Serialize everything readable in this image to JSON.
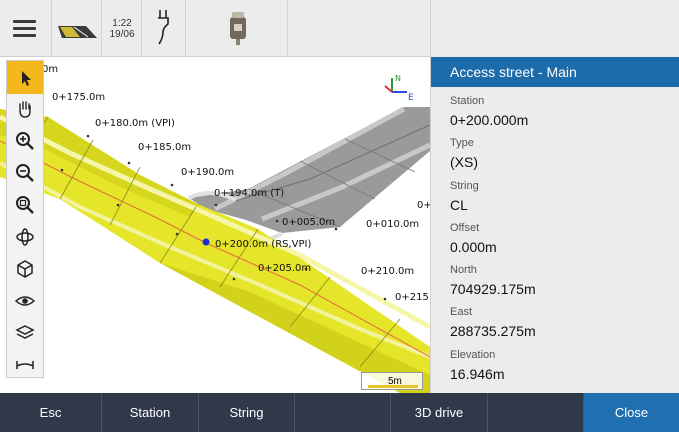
{
  "status_bar": {
    "time": "1:22",
    "date": "19/06",
    "icons": [
      "hamburger-menu-icon",
      "road-icon",
      "power-plug-icon",
      "receiver-icon"
    ]
  },
  "toolbar": {
    "tools": [
      {
        "name": "select-arrow-icon",
        "active": true
      },
      {
        "name": "pan-hand-icon",
        "active": false
      },
      {
        "name": "zoom-in-icon",
        "active": false
      },
      {
        "name": "zoom-out-icon",
        "active": false
      },
      {
        "name": "zoom-extents-icon",
        "active": false
      },
      {
        "name": "orbit-icon",
        "active": false
      },
      {
        "name": "view-cube-icon",
        "active": false
      },
      {
        "name": "visibility-eye-icon",
        "active": false
      },
      {
        "name": "layers-icon",
        "active": false
      },
      {
        "name": "cross-section-icon",
        "active": false
      }
    ]
  },
  "map": {
    "labels": [
      "0m",
      "0+175.0m",
      "0+180.0m (VPI)",
      "0+185.0m",
      "0+190.0m",
      "0+194.0m (T)",
      "0+005.0m",
      "0+010.0m",
      "0+",
      "0+200.0m (RS,VPI)",
      "0+205.0m",
      "0+210.0m",
      "0+215."
    ],
    "axis_labels": {
      "north": "N",
      "east": "E"
    },
    "scale_label": "5m",
    "colors": {
      "road_yellow": "#e5e52a",
      "road_gray": "#9a9a9a",
      "centerline": "#e0603a",
      "selected_point": "#1a2ed8"
    }
  },
  "panel": {
    "title": "Access street - Main",
    "fields": [
      {
        "label": "Station",
        "value": "0+200.000m"
      },
      {
        "label": "Type",
        "value": "(XS)"
      },
      {
        "label": "String",
        "value": "CL"
      },
      {
        "label": "Offset",
        "value": "0.000m"
      },
      {
        "label": "North",
        "value": "704929.175m"
      },
      {
        "label": "East",
        "value": "288735.275m"
      },
      {
        "label": "Elevation",
        "value": "16.946m"
      }
    ],
    "header_color": "#1c6baa"
  },
  "softkeys": [
    "Esc",
    "Station",
    "String",
    "",
    "3D drive",
    "",
    "Close"
  ]
}
